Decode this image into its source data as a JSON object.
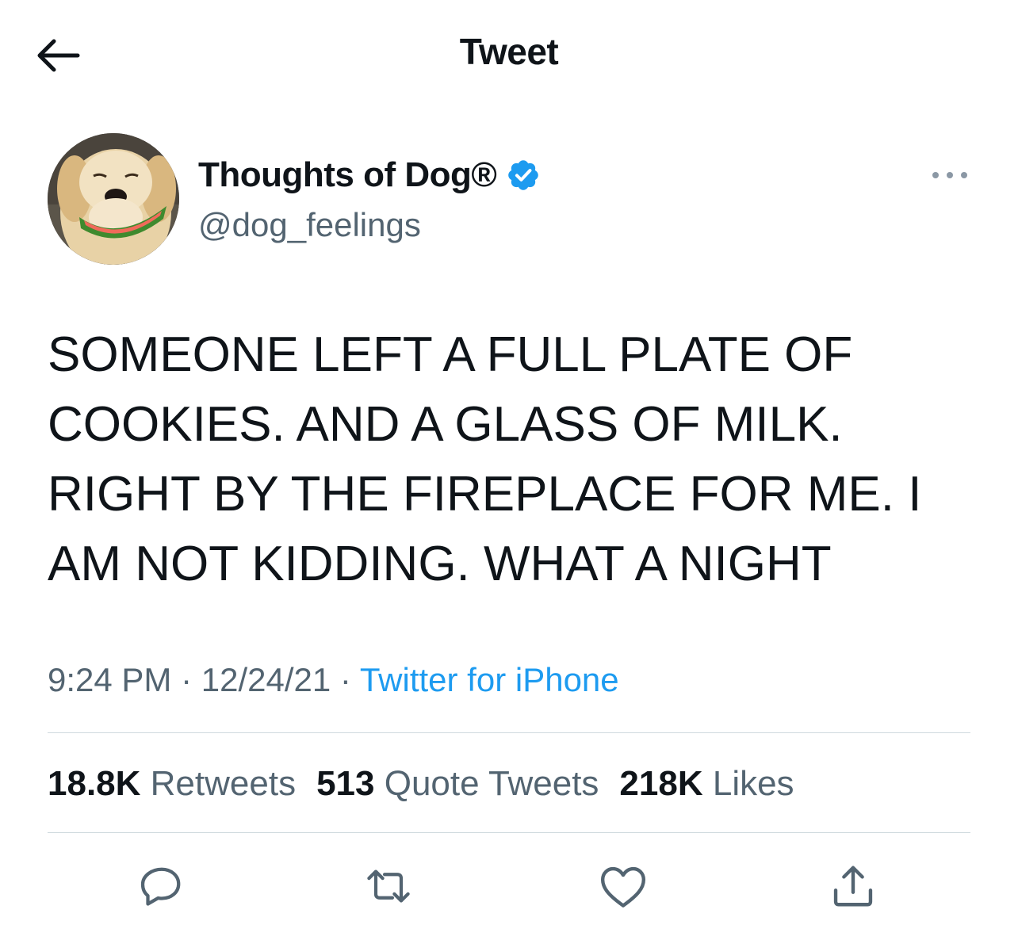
{
  "header": {
    "title": "Tweet",
    "back_icon": "arrow-left-icon"
  },
  "author": {
    "display_name": "Thoughts of Dog®",
    "handle": "@dog_feelings",
    "verified_icon": "verified-badge-icon",
    "avatar": "avatar"
  },
  "more_icon": "more-horizontal-icon",
  "tweet": {
    "text": "SOMEONE LEFT A FULL PLATE OF\nCOOKIES. AND A GLASS OF MILK.\nRIGHT BY THE FIREPLACE FOR ME. I\nAM NOT KIDDING. WHAT A NIGHT"
  },
  "meta": {
    "time": "9:24 PM",
    "separator": " · ",
    "date": "12/24/21",
    "source": "Twitter for iPhone"
  },
  "stats": {
    "retweets_count": "18.8K",
    "retweets_label": "Retweets",
    "quotes_count": "513",
    "quotes_label": "Quote Tweets",
    "likes_count": "218K",
    "likes_label": "Likes"
  },
  "actions": [
    "reply-icon",
    "retweet-icon",
    "like-icon",
    "share-icon"
  ],
  "colors": {
    "text": "#0f1419",
    "secondary": "#536471",
    "accent": "#1d9bf0",
    "divider": "#cfd9de"
  }
}
